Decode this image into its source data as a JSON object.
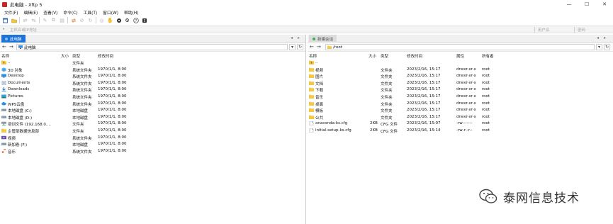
{
  "window": {
    "title": "此电脑 - Xftp 5",
    "minimize_glyph": "—",
    "maximize_glyph": "☐",
    "close_glyph": "✕"
  },
  "menu": [
    "文件(F)",
    "编辑(E)",
    "查看(V)",
    "命令(C)",
    "工具(T)",
    "窗口(W)",
    "帮助(H)"
  ],
  "address_bar": {
    "host_placeholder": "主机名或IP地址",
    "user_placeholder": "用户名",
    "password_placeholder": "密码"
  },
  "left": {
    "tab_label": "此电脑",
    "path": "此电脑",
    "columns": [
      "名称",
      "大小",
      "类型",
      "修改时间"
    ],
    "rows": [
      {
        "name": "..",
        "size": "",
        "type": "文件夹",
        "modified": "",
        "icon": "folder-up"
      },
      {
        "name": "3D 对象",
        "size": "",
        "type": "系统文件夹",
        "modified": "1970/1/1, 8:00",
        "icon": "3d-objects"
      },
      {
        "name": "Desktop",
        "size": "",
        "type": "系统文件夹",
        "modified": "1970/1/1, 8:00",
        "icon": "desktop"
      },
      {
        "name": "Documents",
        "size": "",
        "type": "系统文件夹",
        "modified": "1970/1/1, 8:00",
        "icon": "documents"
      },
      {
        "name": "Downloads",
        "size": "",
        "type": "系统文件夹",
        "modified": "1970/1/1, 8:00",
        "icon": "downloads"
      },
      {
        "name": "Pictures",
        "size": "",
        "type": "系统文件夹",
        "modified": "1970/1/1, 8:00",
        "icon": "pictures"
      },
      {
        "name": "WPS云盘",
        "size": "",
        "type": "系统文件夹",
        "modified": "1970/1/1, 8:00",
        "icon": "cloud"
      },
      {
        "name": "本地磁盘 (C:)",
        "size": "",
        "type": "本地磁盘",
        "modified": "1970/1/1, 8:00",
        "icon": "drive"
      },
      {
        "name": "本地磁盘 (D:)",
        "size": "",
        "type": "本地磁盘",
        "modified": "1970/1/1, 8:00",
        "icon": "drive"
      },
      {
        "name": "培训文件 (192.168.0....",
        "size": "",
        "type": "文件夹",
        "modified": "1970/1/1, 8:00",
        "icon": "network-drive"
      },
      {
        "name": "企管部数据信息部",
        "size": "",
        "type": "文件夹",
        "modified": "1970/1/1, 8:00",
        "icon": "folder"
      },
      {
        "name": "视频",
        "size": "",
        "type": "系统文件夹",
        "modified": "1970/1/1, 8:00",
        "icon": "video"
      },
      {
        "name": "新加卷 (F:)",
        "size": "",
        "type": "本地磁盘",
        "modified": "1970/1/1, 8:00",
        "icon": "drive"
      },
      {
        "name": "音乐",
        "size": "",
        "type": "系统文件夹",
        "modified": "1970/1/1, 8:00",
        "icon": "music"
      }
    ]
  },
  "right": {
    "tab_label": "新建会话",
    "path": "/root",
    "columns": [
      "名称",
      "大小",
      "类型",
      "修改时间",
      "属性",
      "所有者"
    ],
    "rows": [
      {
        "name": "..",
        "size": "",
        "type": "",
        "modified": "",
        "attrs": "",
        "owner": "",
        "icon": "folder-up"
      },
      {
        "name": "视频",
        "size": "",
        "type": "文件夹",
        "modified": "2023/2/16, 15:17",
        "attrs": "drwxr-xr-x",
        "owner": "root",
        "icon": "folder"
      },
      {
        "name": "图片",
        "size": "",
        "type": "文件夹",
        "modified": "2023/2/16, 15:17",
        "attrs": "drwxr-xr-x",
        "owner": "root",
        "icon": "folder"
      },
      {
        "name": "文档",
        "size": "",
        "type": "文件夹",
        "modified": "2023/2/16, 15:17",
        "attrs": "drwxr-xr-x",
        "owner": "root",
        "icon": "folder"
      },
      {
        "name": "下载",
        "size": "",
        "type": "文件夹",
        "modified": "2023/2/16, 15:17",
        "attrs": "drwxr-xr-x",
        "owner": "root",
        "icon": "folder"
      },
      {
        "name": "音乐",
        "size": "",
        "type": "文件夹",
        "modified": "2023/2/16, 15:17",
        "attrs": "drwxr-xr-x",
        "owner": "root",
        "icon": "folder"
      },
      {
        "name": "桌面",
        "size": "",
        "type": "文件夹",
        "modified": "2023/2/16, 15:17",
        "attrs": "drwxr-xr-x",
        "owner": "root",
        "icon": "folder"
      },
      {
        "name": "模板",
        "size": "",
        "type": "文件夹",
        "modified": "2023/2/16, 15:17",
        "attrs": "drwxr-xr-x",
        "owner": "root",
        "icon": "folder"
      },
      {
        "name": "公共",
        "size": "",
        "type": "文件夹",
        "modified": "2023/2/16, 15:17",
        "attrs": "drwxr-xr-x",
        "owner": "root",
        "icon": "folder"
      },
      {
        "name": "anaconda-ks.cfg",
        "size": "2KB",
        "type": "CFG 文件",
        "modified": "2023/2/16, 15:07",
        "attrs": "-rw-------",
        "owner": "root",
        "icon": "file"
      },
      {
        "name": "initial-setup-ks.cfg",
        "size": "2KB",
        "type": "CFG 文件",
        "modified": "2023/2/16, 15:14",
        "attrs": "-rw-r--r--",
        "owner": "root",
        "icon": "file"
      }
    ]
  },
  "watermark": {
    "text": "泰网信息技术",
    "icon": "wechat-icon"
  },
  "colors": {
    "accent": "#1e73d8",
    "folder": "#f5c843",
    "drive": "#7a8b9c"
  }
}
